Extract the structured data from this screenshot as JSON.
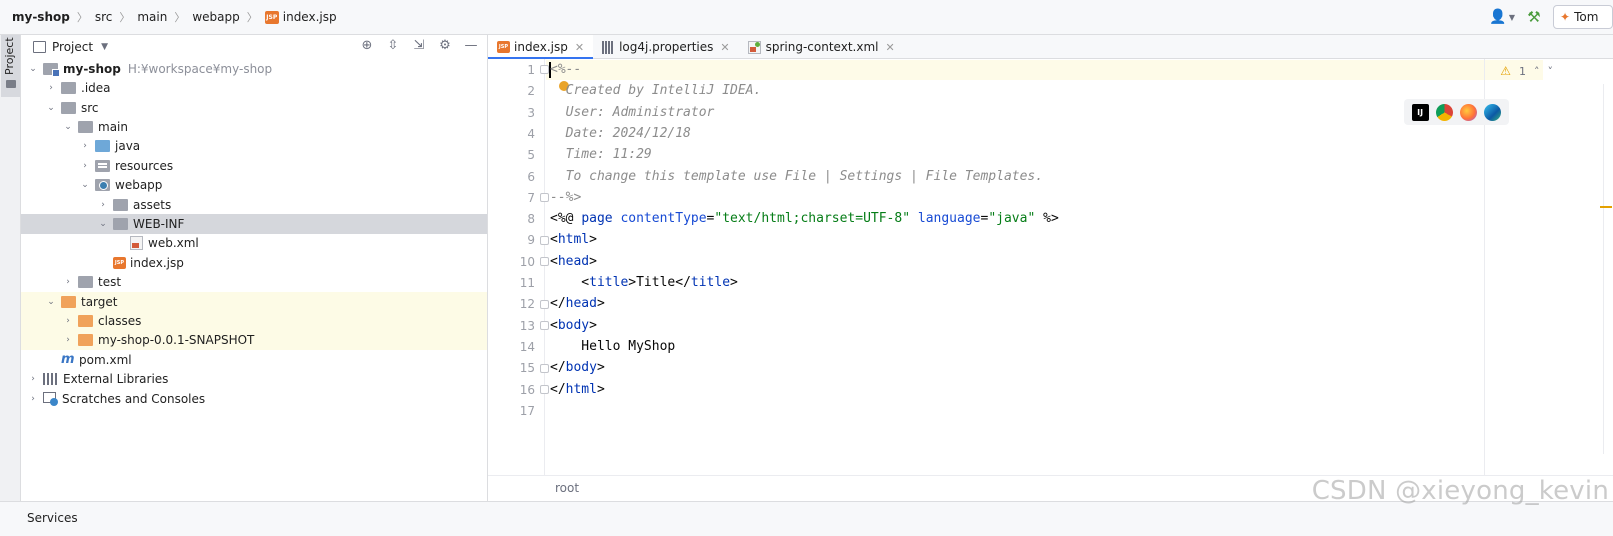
{
  "breadcrumb": {
    "items": [
      "my-shop",
      "src",
      "main",
      "webapp",
      "index.jsp"
    ],
    "file_icon_text": "JSP"
  },
  "toolbar": {
    "run_config_label": "Tom"
  },
  "left_stripe": {
    "project_label": "Project"
  },
  "project_panel": {
    "title": "Project",
    "tree": [
      {
        "label": "my-shop",
        "hint": "H:¥workspace¥my-shop"
      },
      {
        "label": ".idea"
      },
      {
        "label": "src"
      },
      {
        "label": "main"
      },
      {
        "label": "java"
      },
      {
        "label": "resources"
      },
      {
        "label": "webapp"
      },
      {
        "label": "assets"
      },
      {
        "label": "WEB-INF"
      },
      {
        "label": "web.xml"
      },
      {
        "label": "index.jsp"
      },
      {
        "label": "test"
      },
      {
        "label": "target"
      },
      {
        "label": "classes"
      },
      {
        "label": "my-shop-0.0.1-SNAPSHOT"
      },
      {
        "label": "pom.xml"
      },
      {
        "label": "External Libraries"
      },
      {
        "label": "Scratches and Consoles"
      }
    ]
  },
  "editor": {
    "tabs": [
      {
        "label": "index.jsp",
        "active": true
      },
      {
        "label": "log4j.properties"
      },
      {
        "label": "spring-context.xml"
      }
    ],
    "line_numbers": [
      "1",
      "2",
      "3",
      "4",
      "5",
      "6",
      "7",
      "8",
      "9",
      "10",
      "11",
      "12",
      "13",
      "14",
      "15",
      "16",
      "17"
    ],
    "code": {
      "l1": "<%--",
      "l2": "  Created by IntelliJ IDEA.",
      "l3": "  User: Administrator",
      "l4": "  Date: 2024/12/18",
      "l5": "  Time: 11:29",
      "l6": "  To change this template use File | Settings | File Templates.",
      "l7": "--%>",
      "l8_open": "<%@ ",
      "l8_page": "page ",
      "l8_attr1": "contentType",
      "l8_eq1": "=",
      "l8_val1": "\"text/html;charset=UTF-8\"",
      "l8_attr2": " language",
      "l8_eq2": "=",
      "l8_val2": "\"java\"",
      "l8_close": " %>",
      "l9_lt": "<",
      "l9_tag": "html",
      "l9_gt": ">",
      "l10_tag": "head",
      "l11_indent": "    <",
      "l11_tag": "title",
      "l11_text": ">Title</",
      "l11_tag2": "title",
      "l12_lt": "</",
      "l12_tag": "head",
      "l13_tag": "body",
      "l14_text": "    Hello MyShop",
      "l15_tag": "body",
      "l16_tag": "html"
    },
    "inspection_count": "1",
    "browser_ij": "IJ",
    "status_path": "root"
  },
  "bottom_bar": {
    "services_label": "Services"
  },
  "watermark": "CSDN @xieyong_kevin",
  "colors": {
    "accent": "#3574f0",
    "selection": "#d5d7dc",
    "excluded_bg": "#fdfbe6",
    "comment": "#8c8c8c",
    "tag": "#0033b3",
    "string": "#067d17"
  }
}
